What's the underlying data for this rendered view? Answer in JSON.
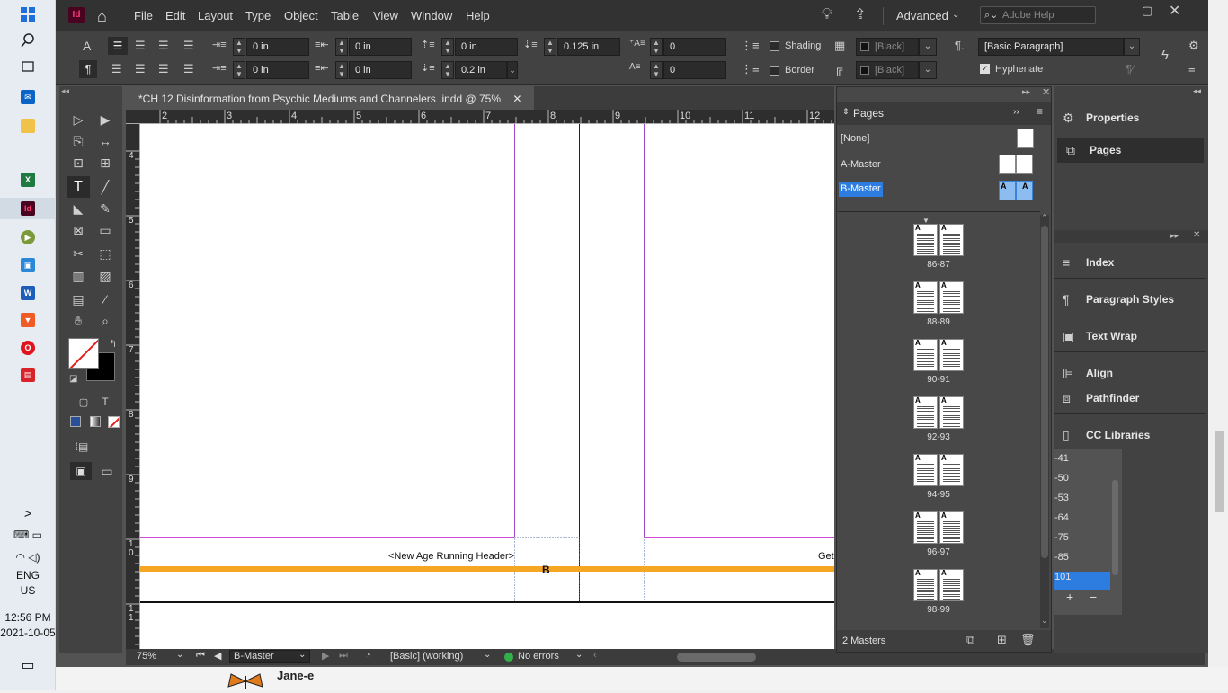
{
  "taskbar": {
    "chevron": ">",
    "clock_time": "12:56 PM",
    "clock_date": "2021-10-05",
    "lang": "ENG",
    "region": "US",
    "icons": [
      "windows-icon",
      "search-icon",
      "task-view-icon",
      "mail-icon",
      "file-explorer-icon",
      "excel-icon",
      "indesign-icon",
      "media-icon",
      "app-icon",
      "word-icon",
      "brave-icon",
      "opera-icon",
      "app-red-icon"
    ]
  },
  "menubar": {
    "app_badge": "Id",
    "menus": [
      "File",
      "Edit",
      "Layout",
      "Type",
      "Object",
      "Table",
      "View",
      "Window",
      "Help"
    ],
    "workspace": "Advanced",
    "search_placeholder": "Adobe Help"
  },
  "control": {
    "left_indent": "0 in",
    "right_indent": "0 in",
    "first_line_indent": "0 in",
    "last_line_indent": "0 in",
    "space_before": "0 in",
    "space_after": "0.125 in",
    "space_after2": "0.2 in",
    "dropcap_lines": "0",
    "dropcap_chars": "0",
    "shading_label": "Shading",
    "border_label": "Border",
    "swatch1": "[Black]",
    "swatch2": "[Black]",
    "paragraph_style": "[Basic Paragraph]",
    "hyphenate_label": "Hyphenate"
  },
  "document": {
    "tab_title": "*CH 12 Disinformation from Psychic Mediums and Channelers .indd @ 75%",
    "running_header": "<New Age Running Header>",
    "right_text": "Get",
    "master_marker": "B"
  },
  "ruler_h": [
    "2",
    "3",
    "4",
    "5",
    "6",
    "7",
    "8",
    "9",
    "10",
    "11",
    "12"
  ],
  "ruler_v": [
    "4",
    "5",
    "6",
    "7",
    "8",
    "9",
    "1",
    "0",
    "1",
    "1"
  ],
  "status": {
    "zoom": "75%",
    "page": "B-Master",
    "preflight_profile": "[Basic] (working)",
    "errors": "No errors"
  },
  "pages_panel": {
    "title": "Pages",
    "masters": [
      {
        "name": "[None]"
      },
      {
        "name": "A-Master"
      },
      {
        "name": "B-Master"
      }
    ],
    "master_letter": "A",
    "spreads": [
      "86-87",
      "88-89",
      "90-91",
      "92-93",
      "94-95",
      "96-97",
      "98-99"
    ],
    "footer": "2 Masters"
  },
  "dock": {
    "items": [
      "Properties",
      "Pages",
      "Index",
      "Paragraph Styles",
      "Text Wrap",
      "Align",
      "Pathfinder",
      "CC Libraries"
    ],
    "numbers": [
      "-41",
      "-50",
      "-53",
      "-64",
      "-75",
      "-85",
      "101"
    ]
  },
  "browser_strip": {
    "user": "Jane-e"
  },
  "colors": {
    "accent_orange": "#f5a623",
    "margin_purple": "#a349c8",
    "selection_blue": "#2d7de0"
  }
}
